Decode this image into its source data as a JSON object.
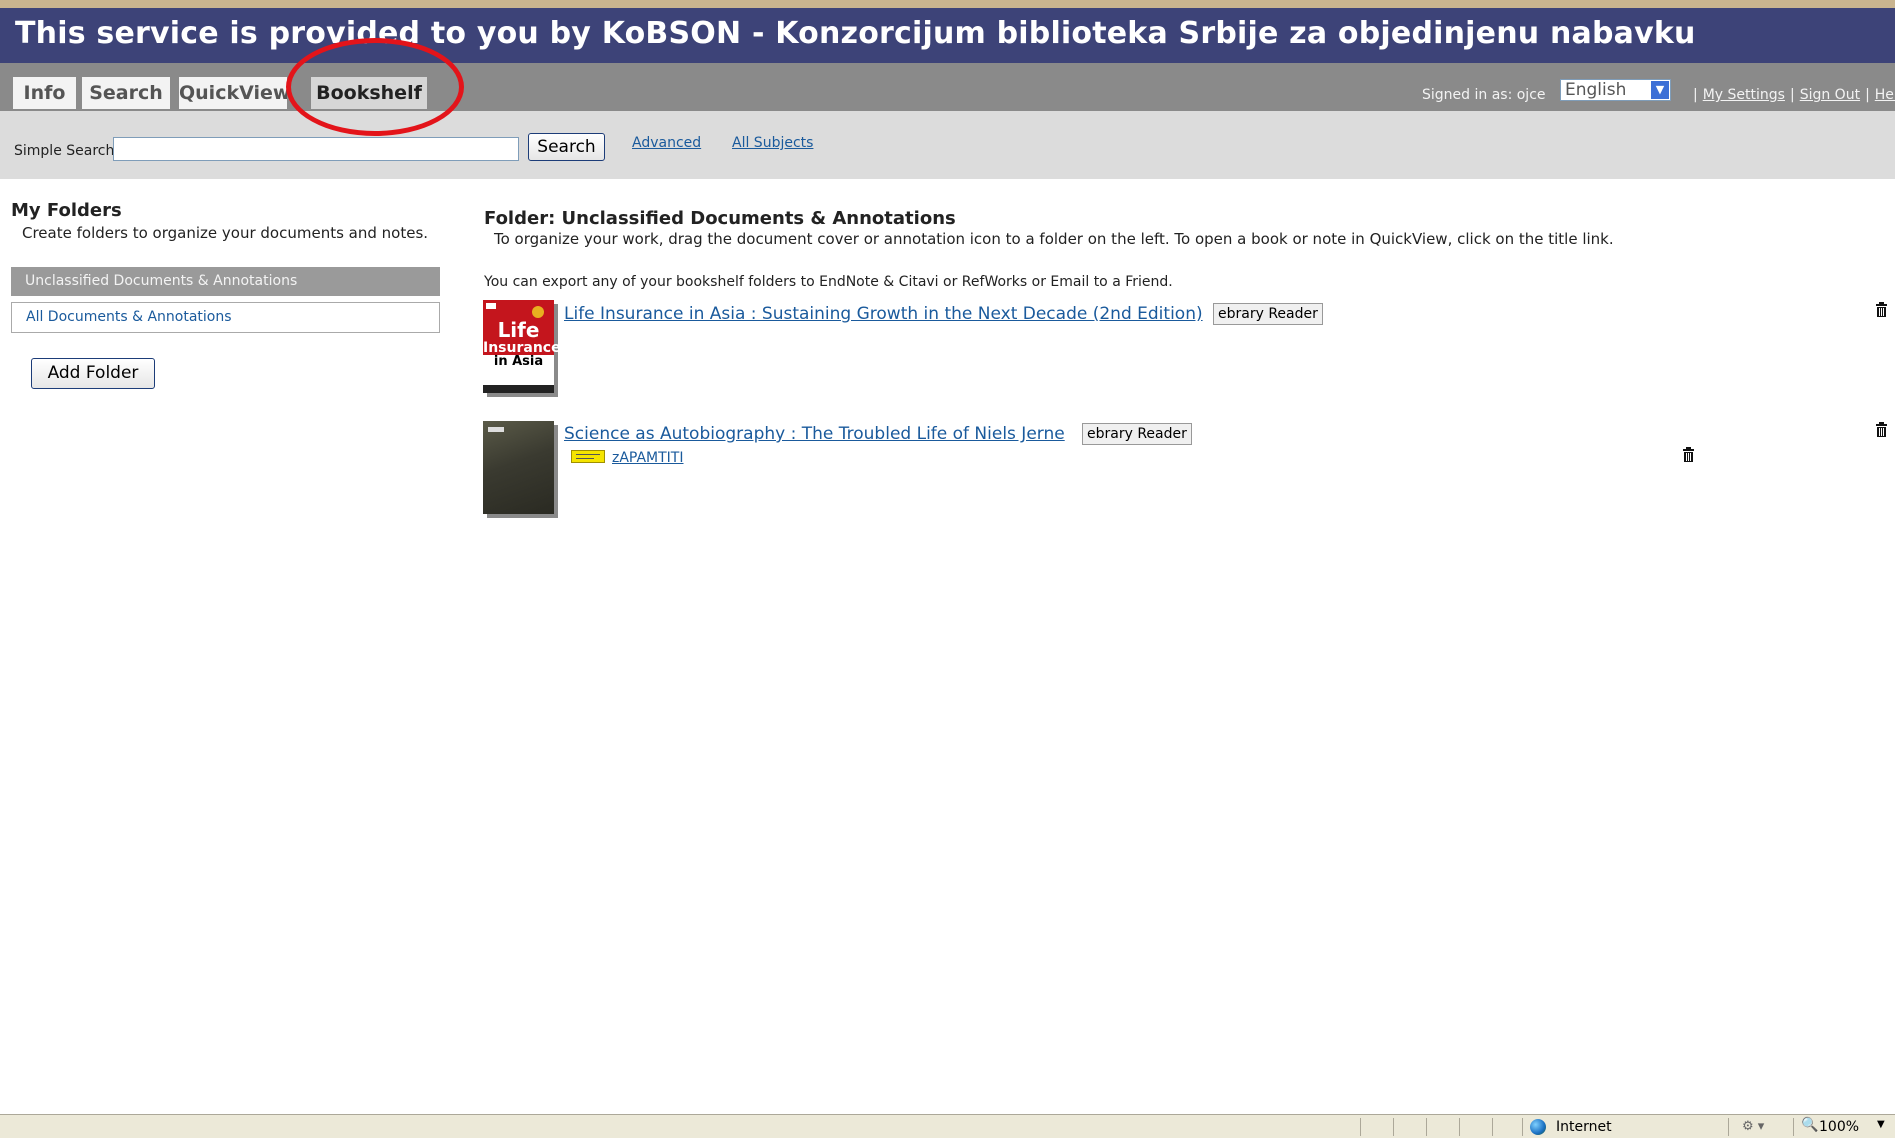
{
  "banner": {
    "text": "This service is provided to you by KoBSON - Konzorcijum biblioteka Srbije za objedinjenu nabavku"
  },
  "tabs": [
    {
      "label": "Info"
    },
    {
      "label": "Search"
    },
    {
      "label": "QuickView"
    },
    {
      "label": "Bookshelf",
      "active": true
    }
  ],
  "user": {
    "signed_in": "Signed in as: ojce",
    "language": "English"
  },
  "top_links": {
    "settings": "My Settings",
    "sign_out": "Sign Out",
    "help": "Help",
    "separator": "|"
  },
  "search": {
    "label": "Simple Search:",
    "value": "",
    "button": "Search",
    "advanced": "Advanced",
    "all_subjects": "All Subjects"
  },
  "sidebar": {
    "title": "My Folders",
    "subtitle": "Create folders to organize your documents and notes.",
    "folders": [
      {
        "label": "Unclassified Documents & Annotations",
        "selected": true
      },
      {
        "label": "All Documents & Annotations",
        "selected": false
      }
    ],
    "add_folder": "Add Folder"
  },
  "main": {
    "folder_title": "Folder: Unclassified Documents & Annotations",
    "instructions": "To organize your work, drag the document cover or annotation icon to a folder on the left. To open a book or note in QuickView, click on the title link.",
    "export_note": "You can export any of your bookshelf folders to EndNote & Citavi or RefWorks or Email to a Friend.",
    "documents": [
      {
        "title": "Life Insurance in Asia : Sustaining Growth in the Next Decade (2nd Edition)",
        "reader_button": "ebrary Reader",
        "cover_text": [
          "Life",
          "Insurance",
          "in Asia"
        ]
      },
      {
        "title": "Science as Autobiography : The Troubled Life of Niels Jerne",
        "reader_button": "ebrary Reader",
        "note": "zAPAMTITI"
      }
    ]
  },
  "statusbar": {
    "zone": "Internet",
    "zoom": "100%"
  },
  "colors": {
    "banner": "#3d4378",
    "navbar": "#8a8a8a",
    "link": "#1a5a9c",
    "highlight_circle": "#e3141a"
  }
}
